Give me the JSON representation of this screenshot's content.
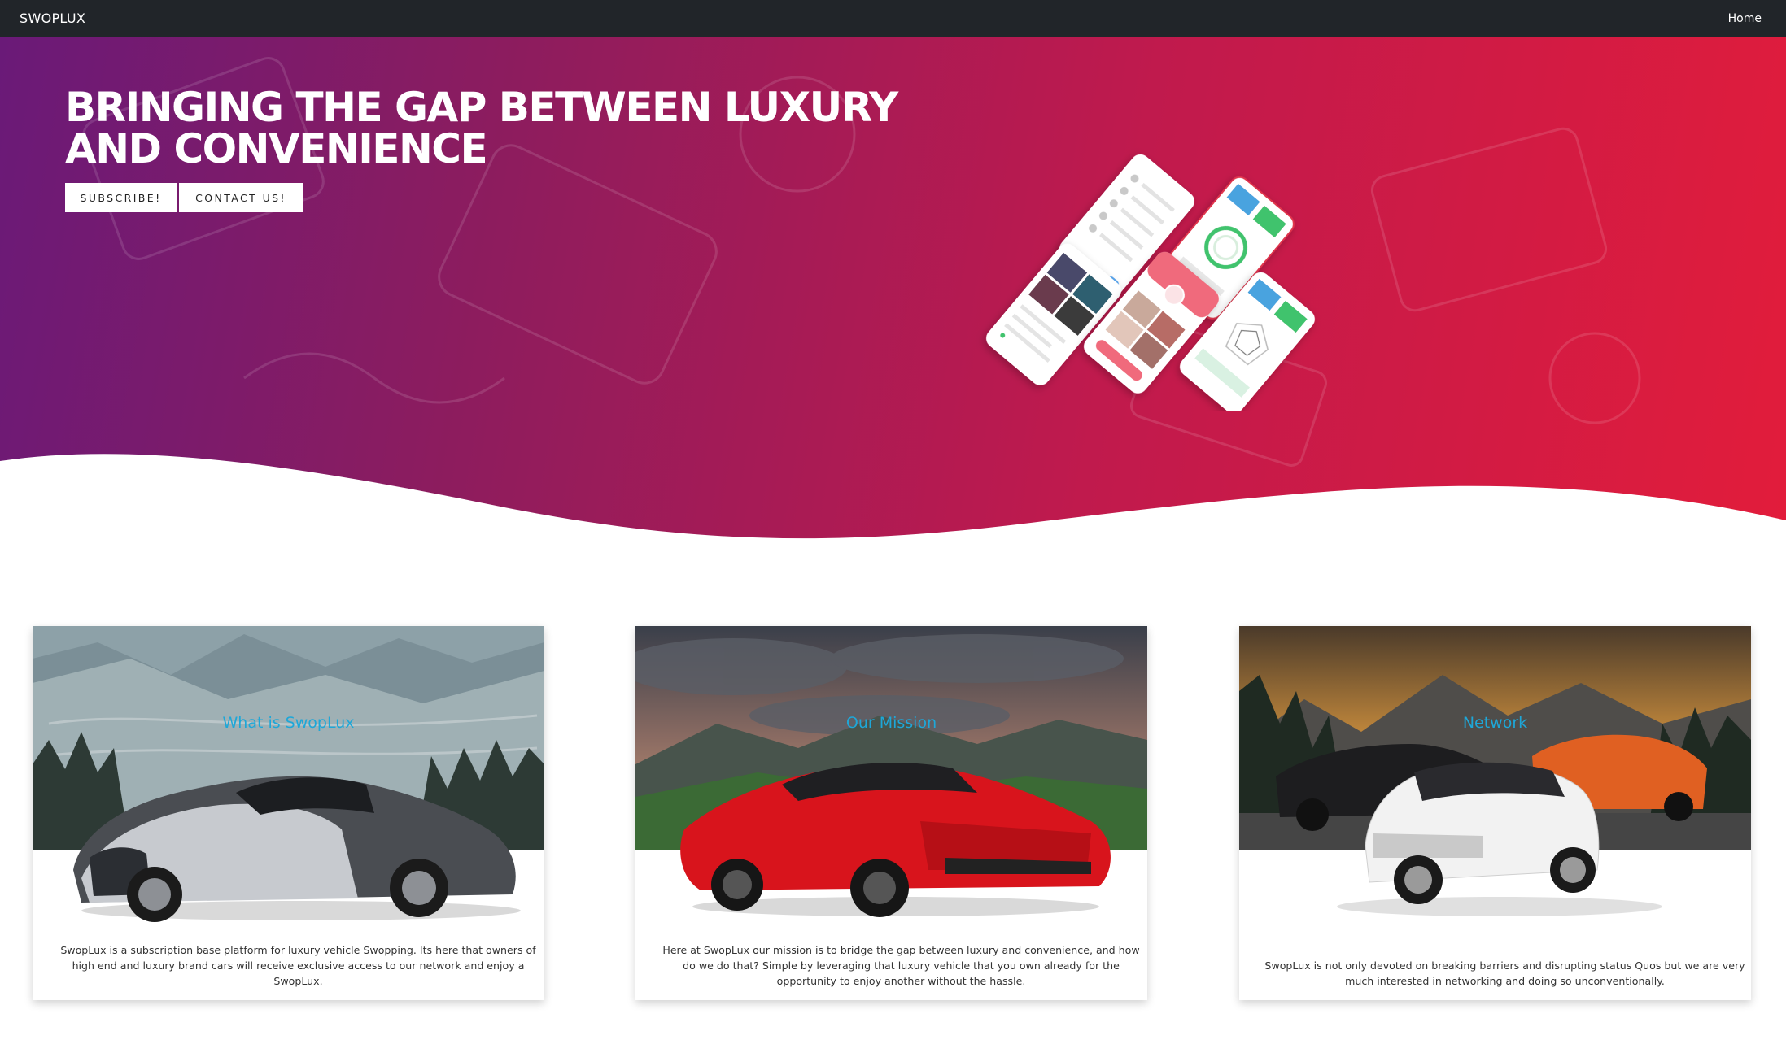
{
  "navbar": {
    "brand": "SWOPLUX",
    "home": "Home"
  },
  "hero": {
    "title_line1": "BRINGING THE GAP BETWEEN LUXURY",
    "title_line2": "AND CONVENIENCE",
    "subscribe_label": "SUBSCRIBE!",
    "contact_label": "CONTACT US!"
  },
  "cards": [
    {
      "title": "What is SwopLux",
      "text": "SwopLux is a subscription base platform for luxury vehicle Swopping. Its here that owners of high end and luxury brand cars will receive exclusive access to our network and enjoy a SwopLux."
    },
    {
      "title": "Our Mission",
      "text": "Here at SwopLux our mission is to bridge the gap between luxury and convenience, and how do we do that? Simple by leveraging that luxury vehicle that you own already for the opportunity to enjoy another without the hassle."
    },
    {
      "title": "Network",
      "text": "SwopLux is not only devoted on breaking barriers and disrupting status Quos but we are very much interested in networking and doing so unconventionally."
    }
  ],
  "colors": {
    "navbar": "#212529",
    "hero_start": "#6a1a78",
    "hero_end": "#e21c3b",
    "card_title": "#1ea7d8"
  }
}
